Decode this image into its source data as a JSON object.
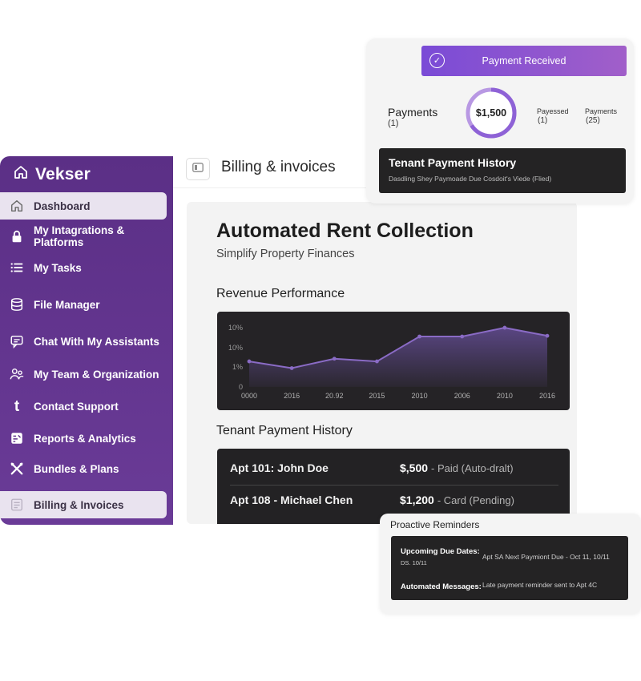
{
  "sidebar": {
    "brand": "Vekser",
    "items": [
      {
        "label": "Dashboard",
        "icon": "home-icon",
        "active": true
      },
      {
        "label": "My Intagrations & Platforms",
        "icon": "lock-icon",
        "active": false
      },
      {
        "label": "My Tasks",
        "icon": "list-icon",
        "active": false
      },
      {
        "label": "File Manager",
        "icon": "database-icon",
        "active": false
      },
      {
        "label": "Chat With My Assistants",
        "icon": "chat-icon",
        "active": false
      },
      {
        "label": "My Team & Organization",
        "icon": "team-icon",
        "active": false
      },
      {
        "label": "Contact Support",
        "icon": "tumblr-icon",
        "glyph": "t",
        "active": false
      },
      {
        "label": "Reports & Analytics",
        "icon": "report-icon",
        "active": false
      },
      {
        "label": "Bundles & Plans",
        "icon": "tools-icon",
        "active": false
      },
      {
        "label": "Billing & Invoices",
        "icon": "billing-icon",
        "active": true
      }
    ]
  },
  "header": {
    "title": "Billing & invoices"
  },
  "main": {
    "title": "Automated Rent Collection",
    "subtitle": "Simplify Property Finances",
    "revenue_title": "Revenue Performance",
    "history_title": "Tenant Payment History",
    "history": [
      {
        "apt": "Apt 101: John Doe",
        "amount": "$,500",
        "status": "- Paid (Auto-dralt)"
      },
      {
        "apt": "Apt 108 - Michael Chen",
        "amount": "$1,200",
        "status": "- Card (Pending)"
      }
    ]
  },
  "chart_data": {
    "type": "area",
    "x_tick_labels": [
      "0000",
      "2016",
      "20.92",
      "2015",
      "2010",
      "2006",
      "2010",
      "2016"
    ],
    "y_tick_labels": [
      "10%",
      "10%",
      "1%",
      "0"
    ],
    "y_values_relative": [
      0.38,
      0.28,
      0.42,
      0.38,
      0.75,
      0.75,
      0.88,
      0.76
    ],
    "colors": {
      "line": "#8a6bc5",
      "fill_top": "#5a4683",
      "fill_bottom": "#2b2730",
      "background": "#252326"
    },
    "grid": false
  },
  "payment_popup": {
    "banner": "Payment Received",
    "payments_label": "Payments",
    "payments_count": "(1)",
    "amount": "$1,500",
    "stat1_label": "Payessed",
    "stat1_value": "(1)",
    "stat2_label": "Payments",
    "stat2_value": "(25)",
    "history_title": "Tenant Payment History",
    "history_sub": "Dasdling Shey Paymoade Due Cosdoit's Viede (Flied)",
    "accent": "#8b5cd6"
  },
  "reminders": {
    "title": "Proactive Reminders",
    "due_label": "Upcoming Due Dates:",
    "due_date": "DS. 10/11",
    "due_text": "Apt SA Next Paymiont Due - Oct 11, 10/11",
    "msg_label": "Automated Messages:",
    "msg_text": "Late payment reminder sent to Apt 4C"
  }
}
